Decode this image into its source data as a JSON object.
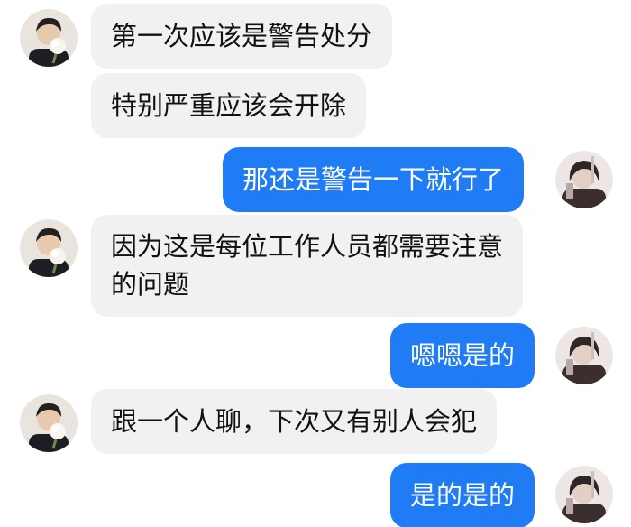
{
  "colors": {
    "incoming_bubble": "#f1f1f3",
    "outgoing_bubble": "#1f7cf5",
    "incoming_text": "#111111",
    "outgoing_text": "#ffffff"
  },
  "messages": [
    {
      "sender": "contact",
      "avatar": "contact-avatar-icon",
      "text": "第一次应该是警告处分"
    },
    {
      "sender": "contact",
      "avatar": "contact-avatar-icon",
      "text": "特别严重应该会开除"
    },
    {
      "sender": "me",
      "avatar": "user-avatar-icon",
      "text": "那还是警告一下就行了"
    },
    {
      "sender": "contact",
      "avatar": "contact-avatar-icon",
      "text": "因为这是每位工作人员都需要注意的问题"
    },
    {
      "sender": "me",
      "avatar": "user-avatar-icon",
      "text": "嗯嗯是的"
    },
    {
      "sender": "contact",
      "avatar": "contact-avatar-icon",
      "text": "跟一个人聊，下次又有别人会犯"
    },
    {
      "sender": "me",
      "avatar": "user-avatar-icon",
      "text": "是的是的"
    }
  ]
}
